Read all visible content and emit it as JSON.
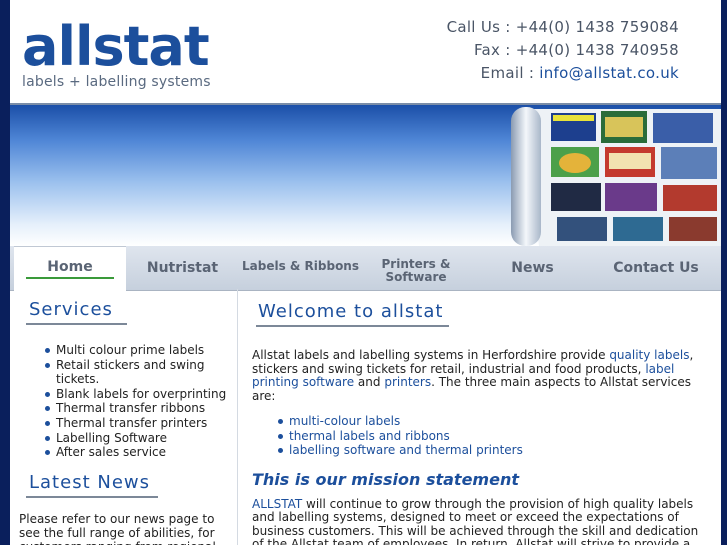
{
  "header": {
    "logo_word": "allstat",
    "logo_tagline": "labels + labelling systems",
    "call_label": "Call Us : ",
    "call_number": "+44(0) 1438 759084",
    "fax_label": "Fax : ",
    "fax_number": "+44(0) 1438 740958",
    "email_label": "Email : ",
    "email_address": "info@allstat.co.uk"
  },
  "nav": {
    "home": "Home",
    "nutristat": "Nutristat",
    "labels_ribbons": "Labels & Ribbons",
    "printers_line1": "Printers &",
    "printers_line2": "Software",
    "news": "News",
    "contact": "Contact Us"
  },
  "services": {
    "title": "Services",
    "items": [
      "Multi colour prime labels",
      "Retail stickers and swing tickets.",
      "Blank labels for overprinting",
      "Thermal transfer ribbons",
      "Thermal transfer printers",
      "Labelling Software",
      "After sales service"
    ]
  },
  "news": {
    "title": "Latest News",
    "text": "Please refer to our news page to see the full range of abilities, for customers ranging from regional"
  },
  "main": {
    "title": "Welcome to allstat",
    "intro_1": "Allstat labels and labelling systems in Herfordshire provide ",
    "link_quality": "quality labels",
    "intro_2": ", stickers and swing tickets for retail, industrial and food products, ",
    "link_software": "label printing software",
    "intro_3": " and ",
    "link_printers": "printers",
    "intro_4": ". The three main aspects to Allstat services are:",
    "aspects": [
      "multi-colour labels",
      "thermal labels and ribbons",
      "labelling software and thermal printers"
    ],
    "mission_title": "This is our mission statement",
    "mission_link": "ALLSTAT",
    "mission_text": " will continue to grow through the provision of high quality labels and labelling systems, designed to meet or exceed the expectations of business customers. This will be achieved through the skill and dedication of the Allstat team of employees. In return, Allstat will strive to provide a secure and stimulating working environment."
  },
  "colors": {
    "brand_blue": "#1c4f9c",
    "background_navy": "#0a1f5c",
    "home_underline": "#3a9a3a"
  }
}
